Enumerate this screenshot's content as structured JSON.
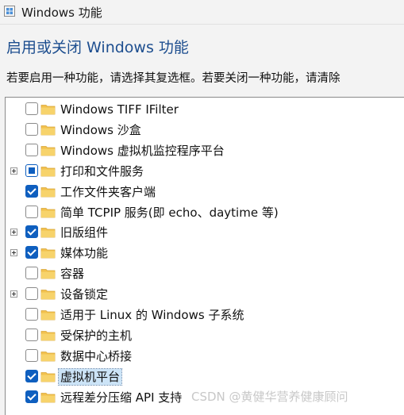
{
  "window": {
    "title": "Windows 功能"
  },
  "heading": "启用或关闭 Windows 功能",
  "instruction": "若要启用一种功能，请选择其复选框。若要关闭一种功能，请清除",
  "features": [
    {
      "label": "Windows TIFF IFilter",
      "state": "unchecked",
      "expandable": false,
      "selected": false
    },
    {
      "label": "Windows 沙盒",
      "state": "unchecked",
      "expandable": false,
      "selected": false
    },
    {
      "label": "Windows 虚拟机监控程序平台",
      "state": "unchecked",
      "expandable": false,
      "selected": false
    },
    {
      "label": "打印和文件服务",
      "state": "partial",
      "expandable": true,
      "selected": false
    },
    {
      "label": "工作文件夹客户端",
      "state": "checked",
      "expandable": false,
      "selected": false
    },
    {
      "label": "简单 TCPIP 服务(即 echo、daytime 等)",
      "state": "unchecked",
      "expandable": false,
      "selected": false
    },
    {
      "label": "旧版组件",
      "state": "checked",
      "expandable": true,
      "selected": false
    },
    {
      "label": "媒体功能",
      "state": "checked",
      "expandable": true,
      "selected": false
    },
    {
      "label": "容器",
      "state": "unchecked",
      "expandable": false,
      "selected": false
    },
    {
      "label": "设备锁定",
      "state": "unchecked",
      "expandable": true,
      "selected": false
    },
    {
      "label": "适用于 Linux 的 Windows 子系统",
      "state": "unchecked",
      "expandable": false,
      "selected": false
    },
    {
      "label": "受保护的主机",
      "state": "unchecked",
      "expandable": false,
      "selected": false
    },
    {
      "label": "数据中心桥接",
      "state": "unchecked",
      "expandable": false,
      "selected": false
    },
    {
      "label": "虚拟机平台",
      "state": "checked",
      "expandable": false,
      "selected": true
    },
    {
      "label": "远程差分压缩 API 支持",
      "state": "checked",
      "expandable": false,
      "selected": false
    }
  ],
  "watermark": "CSDN @黄健华营养健康顾问",
  "colors": {
    "accent": "#0f5fbf",
    "heading": "#1d4e8f",
    "folder": "#f2c14e",
    "selection": "#cce4f7"
  }
}
